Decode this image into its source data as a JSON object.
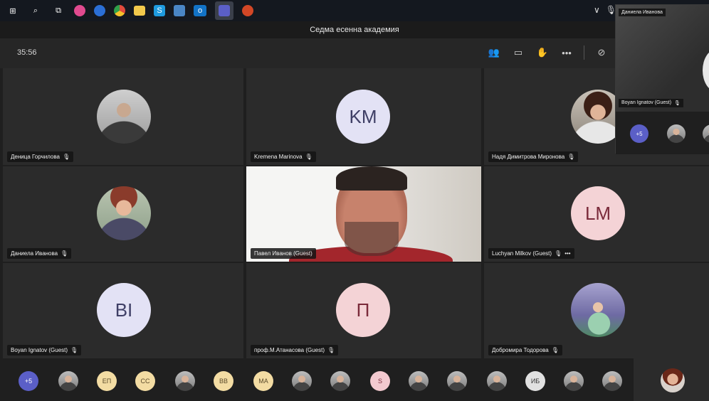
{
  "window": {
    "title": "Седма есенна академия"
  },
  "controls": {
    "timer": "35:56"
  },
  "tiles": [
    {
      "name": "Деница Горчилова"
    },
    {
      "name": "Kremena Marinova",
      "initials": "KM"
    },
    {
      "name": "Надя Димитрова Миронова"
    },
    {
      "name": "Даниела Иванова"
    },
    {
      "name": "Павел Иванов (Guest)"
    },
    {
      "name": "Luchyan Milkov (Guest)",
      "initials": "LM",
      "more": "•••"
    },
    {
      "name": "Boyan Ignatov (Guest)",
      "initials": "BI"
    },
    {
      "name": "проф.М.Атанасова (Guest)",
      "initials": "П"
    },
    {
      "name": "Добромира Тодорова"
    }
  ],
  "strip": {
    "overflow": "+5",
    "initials": [
      "ЕП",
      "СС",
      "ВВ",
      "МА",
      "S",
      "ИБ"
    ]
  },
  "popout": {
    "top_name": "Даниела Иванова",
    "bottom_name": "Boyan Ignatov (Guest)",
    "overflow": "+5"
  },
  "colors": {
    "avatar_purple": "#e3e2f5",
    "avatar_pink": "#f4d3d6",
    "accent": "#5b5fc7"
  }
}
